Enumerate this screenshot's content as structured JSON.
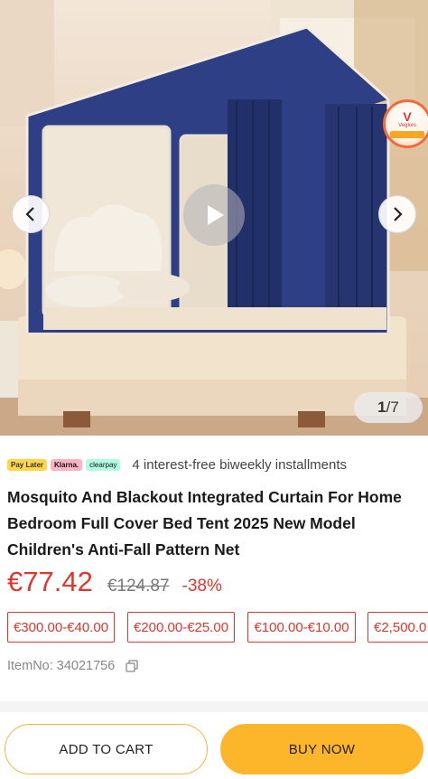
{
  "gallery": {
    "current": "1",
    "total": "/7",
    "prev_icon": "chevron-left-icon",
    "next_icon": "chevron-right-icon",
    "play_icon": "play-icon",
    "brand_badge_text": "Vegkes"
  },
  "payment": {
    "badges": [
      "Pay Later",
      "Klarna.",
      "clearpay"
    ],
    "text": "4 interest-free biweekly installments"
  },
  "product": {
    "title": "Mosquito And Blackout Integrated Curtain For Home Bedroom Full Cover Bed Tent 2025 New Model Children's Anti-Fall Pattern Net",
    "price": "€77.42",
    "old_price": "€124.87",
    "discount": "-38%",
    "item_no": "ItemNo: 34021756",
    "copy_icon": "copy-icon"
  },
  "coupons": [
    "€300.00-€40.00",
    "€200.00-€25.00",
    "€100.00-€10.00",
    "€2,500.0"
  ],
  "actions": {
    "add_to_cart": "ADD TO CART",
    "buy_now": "BUY NOW"
  },
  "colors": {
    "accent_red": "#e0362c",
    "buy_yellow": "#fdb52a",
    "tent_blue": "#2f3f86"
  }
}
